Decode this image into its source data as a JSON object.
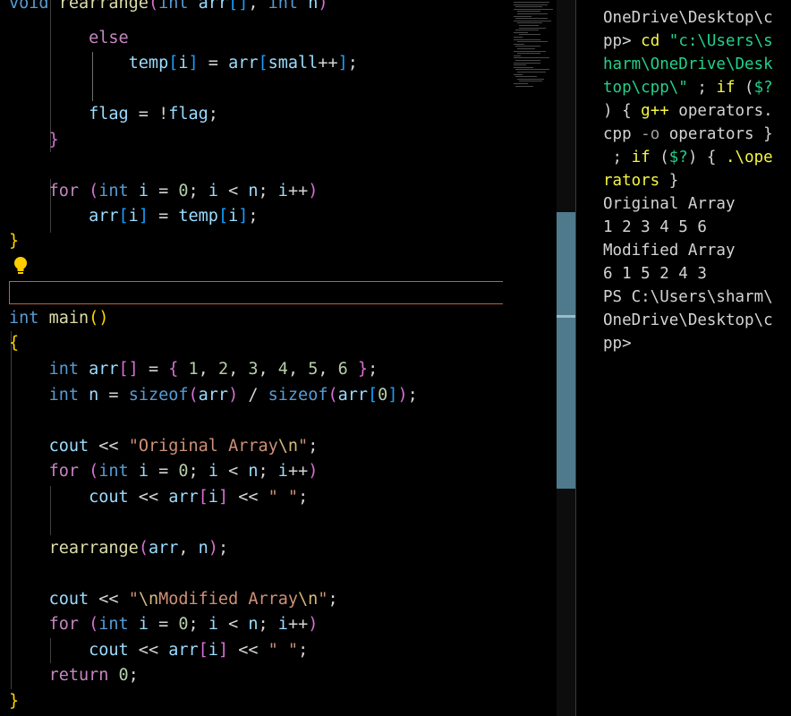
{
  "editor": {
    "lines": [
      {
        "id": "l0",
        "tokens": [
          [
            "void",
            "kw-type"
          ],
          [
            " ",
            "plain"
          ],
          [
            "rearrange",
            "fn"
          ],
          [
            "(",
            "brk2"
          ],
          [
            "int",
            "kw-type"
          ],
          [
            " ",
            "plain"
          ],
          [
            "arr",
            "var"
          ],
          [
            "[]",
            "brk3"
          ],
          [
            ", ",
            "plain"
          ],
          [
            "int",
            "kw-type"
          ],
          [
            " ",
            "plain"
          ],
          [
            "n",
            "var"
          ],
          [
            ")",
            "brk2"
          ]
        ]
      },
      {
        "id": "l1",
        "tokens": [
          [
            "        ",
            "plain"
          ],
          [
            "else",
            "kw-ctrl"
          ]
        ]
      },
      {
        "id": "l2",
        "tokens": [
          [
            "            ",
            "plain"
          ],
          [
            "temp",
            "var"
          ],
          [
            "[",
            "brk3"
          ],
          [
            "i",
            "var"
          ],
          [
            "]",
            "brk3"
          ],
          [
            " = ",
            "plain"
          ],
          [
            "arr",
            "var"
          ],
          [
            "[",
            "brk3"
          ],
          [
            "small",
            "var"
          ],
          [
            "++",
            "plain"
          ],
          [
            "]",
            "brk3"
          ],
          [
            ";",
            "plain"
          ]
        ]
      },
      {
        "id": "l3",
        "tokens": []
      },
      {
        "id": "l4",
        "tokens": [
          [
            "        ",
            "plain"
          ],
          [
            "flag",
            "var"
          ],
          [
            " = !",
            "plain"
          ],
          [
            "flag",
            "var"
          ],
          [
            ";",
            "plain"
          ]
        ]
      },
      {
        "id": "l5",
        "tokens": [
          [
            "    ",
            "plain"
          ],
          [
            "}",
            "brk2"
          ]
        ]
      },
      {
        "id": "l6",
        "tokens": []
      },
      {
        "id": "l7",
        "tokens": [
          [
            "    ",
            "plain"
          ],
          [
            "for",
            "kw-ctrl"
          ],
          [
            " ",
            "plain"
          ],
          [
            "(",
            "brk2"
          ],
          [
            "int",
            "kw-type"
          ],
          [
            " ",
            "plain"
          ],
          [
            "i",
            "var"
          ],
          [
            " = ",
            "plain"
          ],
          [
            "0",
            "num"
          ],
          [
            "; ",
            "plain"
          ],
          [
            "i",
            "var"
          ],
          [
            " < ",
            "plain"
          ],
          [
            "n",
            "var"
          ],
          [
            "; ",
            "plain"
          ],
          [
            "i",
            "var"
          ],
          [
            "++",
            "plain"
          ],
          [
            ")",
            "brk2"
          ]
        ]
      },
      {
        "id": "l8",
        "tokens": [
          [
            "        ",
            "plain"
          ],
          [
            "arr",
            "var"
          ],
          [
            "[",
            "brk3"
          ],
          [
            "i",
            "var"
          ],
          [
            "]",
            "brk3"
          ],
          [
            " = ",
            "plain"
          ],
          [
            "temp",
            "var"
          ],
          [
            "[",
            "brk3"
          ],
          [
            "i",
            "var"
          ],
          [
            "]",
            "brk3"
          ],
          [
            ";",
            "plain"
          ]
        ]
      },
      {
        "id": "l9",
        "tokens": [
          [
            "}",
            "brk1"
          ]
        ]
      },
      {
        "id": "l10",
        "tokens": []
      },
      {
        "id": "l11",
        "tokens": []
      },
      {
        "id": "l12",
        "tokens": [
          [
            "int",
            "kw-type"
          ],
          [
            " ",
            "plain"
          ],
          [
            "main",
            "fn"
          ],
          [
            "()",
            "brk1"
          ]
        ]
      },
      {
        "id": "l13",
        "tokens": [
          [
            "{",
            "brk1"
          ]
        ]
      },
      {
        "id": "l14",
        "tokens": [
          [
            "    ",
            "plain"
          ],
          [
            "int",
            "kw-type"
          ],
          [
            " ",
            "plain"
          ],
          [
            "arr",
            "var"
          ],
          [
            "[]",
            "brk2"
          ],
          [
            " = ",
            "plain"
          ],
          [
            "{",
            "brk2"
          ],
          [
            " ",
            "plain"
          ],
          [
            "1",
            "num"
          ],
          [
            ", ",
            "plain"
          ],
          [
            "2",
            "num"
          ],
          [
            ", ",
            "plain"
          ],
          [
            "3",
            "num"
          ],
          [
            ", ",
            "plain"
          ],
          [
            "4",
            "num"
          ],
          [
            ", ",
            "plain"
          ],
          [
            "5",
            "num"
          ],
          [
            ", ",
            "plain"
          ],
          [
            "6",
            "num"
          ],
          [
            " ",
            "plain"
          ],
          [
            "}",
            "brk2"
          ],
          [
            ";",
            "plain"
          ]
        ]
      },
      {
        "id": "l15",
        "tokens": [
          [
            "    ",
            "plain"
          ],
          [
            "int",
            "kw-type"
          ],
          [
            " ",
            "plain"
          ],
          [
            "n",
            "var"
          ],
          [
            " = ",
            "plain"
          ],
          [
            "sizeof",
            "kw-type"
          ],
          [
            "(",
            "brk2"
          ],
          [
            "arr",
            "var"
          ],
          [
            ")",
            "brk2"
          ],
          [
            " / ",
            "plain"
          ],
          [
            "sizeof",
            "kw-type"
          ],
          [
            "(",
            "brk2"
          ],
          [
            "arr",
            "var"
          ],
          [
            "[",
            "brk3"
          ],
          [
            "0",
            "num"
          ],
          [
            "]",
            "brk3"
          ],
          [
            ")",
            "brk2"
          ],
          [
            ";",
            "plain"
          ]
        ]
      },
      {
        "id": "l16",
        "tokens": []
      },
      {
        "id": "l17",
        "tokens": [
          [
            "    ",
            "plain"
          ],
          [
            "cout",
            "var"
          ],
          [
            " << ",
            "plain"
          ],
          [
            "\"Original Array",
            "str"
          ],
          [
            "\\n",
            "esc"
          ],
          [
            "\"",
            "str"
          ],
          [
            ";",
            "plain"
          ]
        ]
      },
      {
        "id": "l18",
        "tokens": [
          [
            "    ",
            "plain"
          ],
          [
            "for",
            "kw-ctrl"
          ],
          [
            " ",
            "plain"
          ],
          [
            "(",
            "brk2"
          ],
          [
            "int",
            "kw-type"
          ],
          [
            " ",
            "plain"
          ],
          [
            "i",
            "var"
          ],
          [
            " = ",
            "plain"
          ],
          [
            "0",
            "num"
          ],
          [
            "; ",
            "plain"
          ],
          [
            "i",
            "var"
          ],
          [
            " < ",
            "plain"
          ],
          [
            "n",
            "var"
          ],
          [
            "; ",
            "plain"
          ],
          [
            "i",
            "var"
          ],
          [
            "++",
            "plain"
          ],
          [
            ")",
            "brk2"
          ]
        ]
      },
      {
        "id": "l19",
        "tokens": [
          [
            "        ",
            "plain"
          ],
          [
            "cout",
            "var"
          ],
          [
            " << ",
            "plain"
          ],
          [
            "arr",
            "var"
          ],
          [
            "[",
            "brk2"
          ],
          [
            "i",
            "var"
          ],
          [
            "]",
            "brk2"
          ],
          [
            " << ",
            "plain"
          ],
          [
            "\" \"",
            "str"
          ],
          [
            ";",
            "plain"
          ]
        ]
      },
      {
        "id": "l20",
        "tokens": []
      },
      {
        "id": "l21",
        "tokens": [
          [
            "    ",
            "plain"
          ],
          [
            "rearrange",
            "fn"
          ],
          [
            "(",
            "brk2"
          ],
          [
            "arr",
            "var"
          ],
          [
            ", ",
            "plain"
          ],
          [
            "n",
            "var"
          ],
          [
            ")",
            "brk2"
          ],
          [
            ";",
            "plain"
          ]
        ]
      },
      {
        "id": "l22",
        "tokens": []
      },
      {
        "id": "l23",
        "tokens": [
          [
            "    ",
            "plain"
          ],
          [
            "cout",
            "var"
          ],
          [
            " << ",
            "plain"
          ],
          [
            "\"",
            "str"
          ],
          [
            "\\n",
            "esc"
          ],
          [
            "Modified Array",
            "str"
          ],
          [
            "\\n",
            "esc"
          ],
          [
            "\"",
            "str"
          ],
          [
            ";",
            "plain"
          ]
        ]
      },
      {
        "id": "l24",
        "tokens": [
          [
            "    ",
            "plain"
          ],
          [
            "for",
            "kw-ctrl"
          ],
          [
            " ",
            "plain"
          ],
          [
            "(",
            "brk2"
          ],
          [
            "int",
            "kw-type"
          ],
          [
            " ",
            "plain"
          ],
          [
            "i",
            "var"
          ],
          [
            " = ",
            "plain"
          ],
          [
            "0",
            "num"
          ],
          [
            "; ",
            "plain"
          ],
          [
            "i",
            "var"
          ],
          [
            " < ",
            "plain"
          ],
          [
            "n",
            "var"
          ],
          [
            "; ",
            "plain"
          ],
          [
            "i",
            "var"
          ],
          [
            "++",
            "plain"
          ],
          [
            ")",
            "brk2"
          ]
        ]
      },
      {
        "id": "l25",
        "tokens": [
          [
            "        ",
            "plain"
          ],
          [
            "cout",
            "var"
          ],
          [
            " << ",
            "plain"
          ],
          [
            "arr",
            "var"
          ],
          [
            "[",
            "brk2"
          ],
          [
            "i",
            "var"
          ],
          [
            "]",
            "brk2"
          ],
          [
            " << ",
            "plain"
          ],
          [
            "\" \"",
            "str"
          ],
          [
            ";",
            "plain"
          ]
        ]
      },
      {
        "id": "l26",
        "tokens": [
          [
            "    ",
            "plain"
          ],
          [
            "return",
            "kw-ctrl"
          ],
          [
            " ",
            "plain"
          ],
          [
            "0",
            "num"
          ],
          [
            ";",
            "plain"
          ]
        ]
      },
      {
        "id": "l27",
        "tokens": [
          [
            "}",
            "brk1"
          ]
        ]
      }
    ]
  },
  "terminal": {
    "lines": [
      {
        "id": "t0",
        "tokens": [
          [
            "OneDrive\\Desktop\\c",
            "plain"
          ]
        ]
      },
      {
        "id": "t1",
        "tokens": [
          [
            "pp> ",
            "plain"
          ],
          [
            "cd",
            "t-cmd"
          ],
          [
            " ",
            "plain"
          ],
          [
            "\"c:\\Users\\s",
            "t-str"
          ]
        ]
      },
      {
        "id": "t2",
        "tokens": [
          [
            "harm\\OneDrive\\Desk",
            "t-str"
          ]
        ]
      },
      {
        "id": "t3",
        "tokens": [
          [
            "top\\cpp\\\"",
            "t-str"
          ],
          [
            " ; ",
            "plain"
          ],
          [
            "if",
            "t-cmd"
          ],
          [
            " (",
            "plain"
          ],
          [
            "$?",
            "t-str"
          ]
        ]
      },
      {
        "id": "t4",
        "tokens": [
          [
            ") { ",
            "plain"
          ],
          [
            "g++",
            "t-cmd"
          ],
          [
            " operators.",
            "plain"
          ]
        ]
      },
      {
        "id": "t5",
        "tokens": [
          [
            "cpp ",
            "plain"
          ],
          [
            "-o",
            "t-op"
          ],
          [
            " operators }",
            "plain"
          ]
        ]
      },
      {
        "id": "t6",
        "tokens": [
          [
            " ; ",
            "plain"
          ],
          [
            "if",
            "t-cmd"
          ],
          [
            " (",
            "plain"
          ],
          [
            "$?",
            "t-str"
          ],
          [
            ") { ",
            "plain"
          ],
          [
            ".\\ope",
            "t-cmd"
          ]
        ]
      },
      {
        "id": "t7",
        "tokens": [
          [
            "rators",
            "t-cmd"
          ],
          [
            " }",
            "plain"
          ]
        ]
      },
      {
        "id": "t8",
        "tokens": [
          [
            "Original Array",
            "plain"
          ]
        ]
      },
      {
        "id": "t9",
        "tokens": [
          [
            "1 2 3 4 5 6",
            "plain"
          ]
        ]
      },
      {
        "id": "t10",
        "tokens": [
          [
            "Modified Array",
            "plain"
          ]
        ]
      },
      {
        "id": "t11",
        "tokens": [
          [
            "6 1 5 2 4 3",
            "plain"
          ]
        ]
      },
      {
        "id": "t12",
        "tokens": [
          [
            "PS C:\\Users\\sharm\\",
            "plain"
          ]
        ]
      },
      {
        "id": "t13",
        "tokens": [
          [
            "OneDrive\\Desktop\\c",
            "plain"
          ]
        ]
      },
      {
        "id": "t14",
        "tokens": [
          [
            "pp>",
            "plain"
          ]
        ]
      }
    ]
  },
  "colors": {
    "background": "#000000",
    "current_line_border": "#c0623a",
    "scrollbar_thumb": "#4e7a8c",
    "lightbulb": "#ffcc00"
  },
  "icons": {
    "lightbulb": "lightbulb-icon"
  }
}
